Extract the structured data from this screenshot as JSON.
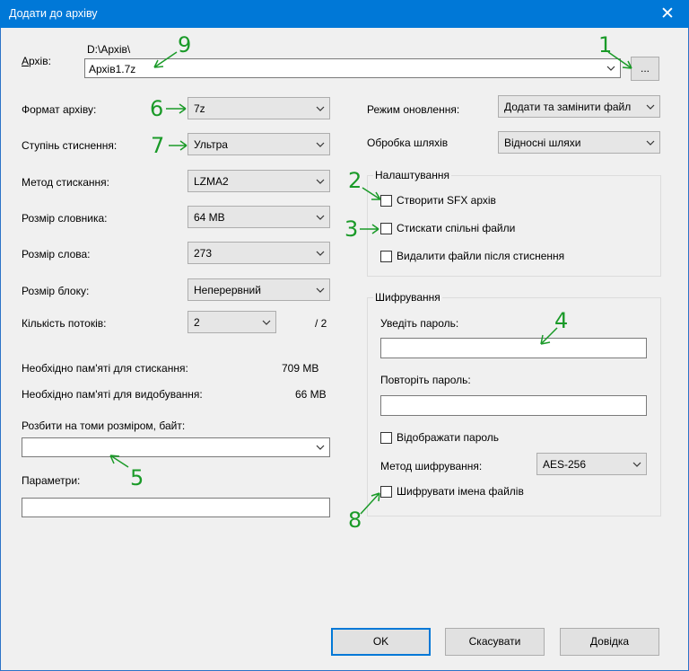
{
  "window": {
    "title": "Додати до архіву",
    "close_glyph": "✕"
  },
  "archive": {
    "label": "Архів:",
    "path": "D:\\Архів\\",
    "name": "Архів1.7z",
    "browse_label": "..."
  },
  "left": {
    "format": {
      "label": "Формат архіву:",
      "value": "7z"
    },
    "level": {
      "label": "Ступінь стиснення:",
      "value": "Ультра"
    },
    "method": {
      "label": "Метод стискання:",
      "value": "LZMA2"
    },
    "dict": {
      "label": "Розмір словника:",
      "value": "64 MB"
    },
    "word": {
      "label": "Розмір слова:",
      "value": "273"
    },
    "block": {
      "label": "Розмір блоку:",
      "value": "Неперервний"
    },
    "threads": {
      "label": "Кількість потоків:",
      "value": "2",
      "max": "/ 2"
    },
    "mem_compress": {
      "label": "Необхідно пам'яті для стискання:",
      "value": "709 MB"
    },
    "mem_extract": {
      "label": "Необхідно пам'яті для видобування:",
      "value": "66 MB"
    },
    "split": {
      "label": "Розбити на томи розміром, байт:",
      "value": ""
    },
    "params": {
      "label": "Параметри:",
      "value": ""
    }
  },
  "right": {
    "update": {
      "label": "Режим оновлення:",
      "value": "Додати та замінити файл"
    },
    "paths": {
      "label": "Обробка шляхів",
      "value": "Відносні шляхи"
    },
    "options": {
      "title": "Налаштування",
      "sfx": "Створити SFX архів",
      "shared": "Стискати спільні файли",
      "delete": "Видалити файли після стиснення"
    },
    "encryption": {
      "title": "Шифрування",
      "password_label": "Уведіть пароль:",
      "password_value": "",
      "repeat_label": "Повторіть пароль:",
      "repeat_value": "",
      "show_password": "Відображати пароль",
      "method_label": "Метод шифрування:",
      "method_value": "AES-256",
      "encrypt_names": "Шифрувати імена файлів"
    }
  },
  "buttons": {
    "ok": "OK",
    "cancel": "Скасувати",
    "help": "Довідка"
  },
  "annotations": {
    "color": "#1a9a28",
    "labels": [
      "1",
      "2",
      "3",
      "4",
      "5",
      "6",
      "7",
      "8",
      "9"
    ]
  },
  "colors": {
    "titlebar": "#0078d7",
    "dialog_bg": "#f0f0f0"
  }
}
